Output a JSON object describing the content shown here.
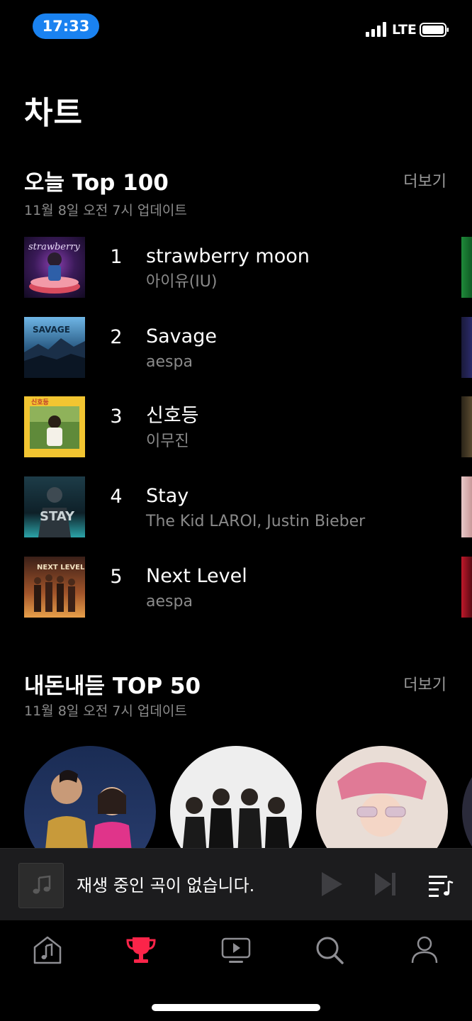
{
  "status": {
    "time": "17:33",
    "network": "LTE"
  },
  "page": {
    "title": "차트"
  },
  "top100": {
    "title": "오늘 Top 100",
    "updated": "11월 8일 오전 7시 업데이트",
    "more": "더보기",
    "items": [
      {
        "rank": "1",
        "title": "strawberry moon",
        "artist": "아이유(IU)"
      },
      {
        "rank": "2",
        "title": "Savage",
        "artist": "aespa"
      },
      {
        "rank": "3",
        "title": "신호등",
        "artist": "이무진"
      },
      {
        "rank": "4",
        "title": "Stay",
        "artist": "The Kid LAROI, Justin Bieber"
      },
      {
        "rank": "5",
        "title": "Next Level",
        "artist": "aespa"
      }
    ]
  },
  "top50": {
    "title": "내돈내듣 TOP 50",
    "updated": "11월 8일 오전 7시 업데이트",
    "more": "더보기"
  },
  "player": {
    "status": "재생 중인 곡이 없습니다."
  },
  "nav": {
    "items": [
      {
        "icon": "music-note-icon",
        "active": false
      },
      {
        "icon": "trophy-icon",
        "active": true
      },
      {
        "icon": "video-play-icon",
        "active": false
      },
      {
        "icon": "search-icon",
        "active": false
      },
      {
        "icon": "profile-icon",
        "active": false
      }
    ],
    "active_color": "#fc2449"
  }
}
